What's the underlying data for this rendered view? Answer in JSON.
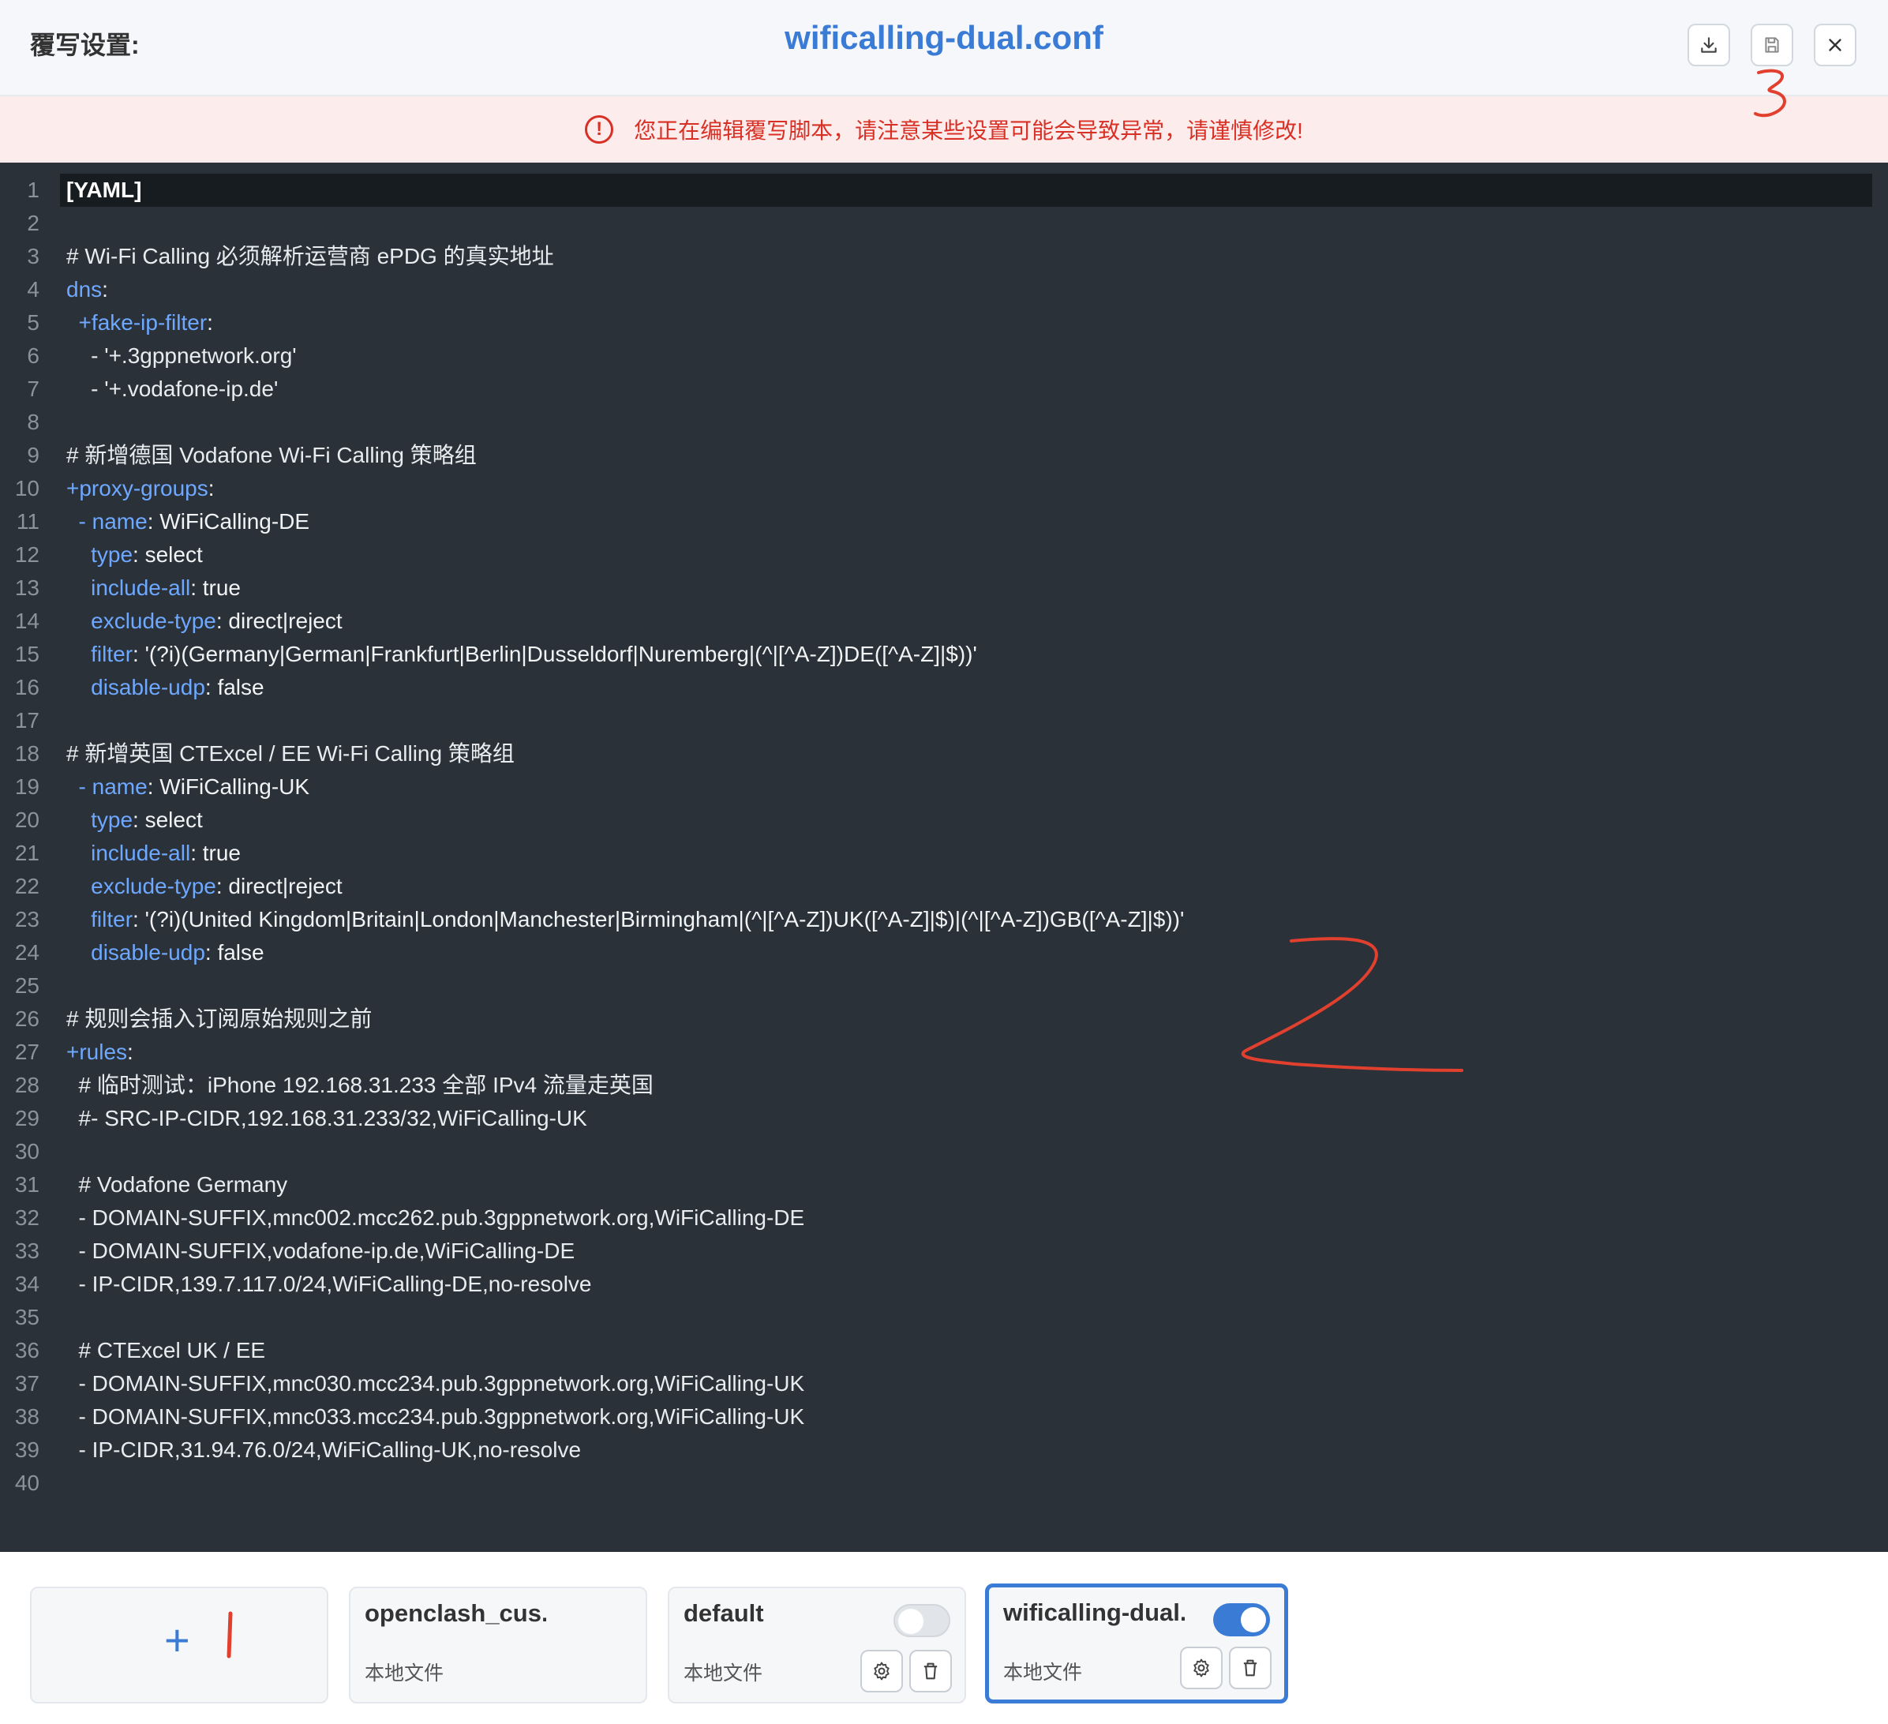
{
  "header": {
    "left_title": "覆写设置:",
    "file_title": "wificalling-dual.conf",
    "buttons": {
      "download": "download-icon",
      "save": "save-icon",
      "close": "close-icon"
    }
  },
  "warning": {
    "icon": "!",
    "text": "您正在编辑覆写脚本，请注意某些设置可能会导致异常，请谨慎修改!"
  },
  "editor": {
    "lines": [
      {
        "n": "1",
        "t": "[YAML]"
      },
      {
        "n": "2",
        "t": ""
      },
      {
        "n": "3",
        "t": "# Wi-Fi Calling 必须解析运营商 ePDG 的真实地址"
      },
      {
        "n": "4",
        "t": "dns:"
      },
      {
        "n": "5",
        "t": "  +fake-ip-filter:"
      },
      {
        "n": "6",
        "t": "    - '+.3gppnetwork.org'"
      },
      {
        "n": "7",
        "t": "    - '+.vodafone-ip.de'"
      },
      {
        "n": "8",
        "t": ""
      },
      {
        "n": "9",
        "t": "# 新增德国 Vodafone Wi-Fi Calling 策略组"
      },
      {
        "n": "10",
        "t": "+proxy-groups:"
      },
      {
        "n": "11",
        "t": "  - name: WiFiCalling-DE"
      },
      {
        "n": "12",
        "t": "    type: select"
      },
      {
        "n": "13",
        "t": "    include-all: true"
      },
      {
        "n": "14",
        "t": "    exclude-type: direct|reject"
      },
      {
        "n": "15",
        "t": "    filter: '(?i)(Germany|German|Frankfurt|Berlin|Dusseldorf|Nuremberg|(^|[^A-Z])DE([^A-Z]|$))'"
      },
      {
        "n": "16",
        "t": "    disable-udp: false"
      },
      {
        "n": "17",
        "t": ""
      },
      {
        "n": "18",
        "t": "# 新增英国 CTExcel / EE Wi-Fi Calling 策略组"
      },
      {
        "n": "19",
        "t": "  - name: WiFiCalling-UK"
      },
      {
        "n": "20",
        "t": "    type: select"
      },
      {
        "n": "21",
        "t": "    include-all: true"
      },
      {
        "n": "22",
        "t": "    exclude-type: direct|reject"
      },
      {
        "n": "23",
        "t": "    filter: '(?i)(United Kingdom|Britain|London|Manchester|Birmingham|(^|[^A-Z])UK([^A-Z]|$)|(^|[^A-Z])GB([^A-Z]|$))'"
      },
      {
        "n": "24",
        "t": "    disable-udp: false"
      },
      {
        "n": "25",
        "t": ""
      },
      {
        "n": "26",
        "t": "# 规则会插入订阅原始规则之前"
      },
      {
        "n": "27",
        "t": "+rules:"
      },
      {
        "n": "28",
        "t": "  # 临时测试：iPhone 192.168.31.233 全部 IPv4 流量走英国"
      },
      {
        "n": "29",
        "t": "  #- SRC-IP-CIDR,192.168.31.233/32,WiFiCalling-UK"
      },
      {
        "n": "30",
        "t": ""
      },
      {
        "n": "31",
        "t": "  # Vodafone Germany"
      },
      {
        "n": "32",
        "t": "  - DOMAIN-SUFFIX,mnc002.mcc262.pub.3gppnetwork.org,WiFiCalling-DE"
      },
      {
        "n": "33",
        "t": "  - DOMAIN-SUFFIX,vodafone-ip.de,WiFiCalling-DE"
      },
      {
        "n": "34",
        "t": "  - IP-CIDR,139.7.117.0/24,WiFiCalling-DE,no-resolve"
      },
      {
        "n": "35",
        "t": ""
      },
      {
        "n": "36",
        "t": "  # CTExcel UK / EE"
      },
      {
        "n": "37",
        "t": "  - DOMAIN-SUFFIX,mnc030.mcc234.pub.3gppnetwork.org,WiFiCalling-UK"
      },
      {
        "n": "38",
        "t": "  - DOMAIN-SUFFIX,mnc033.mcc234.pub.3gppnetwork.org,WiFiCalling-UK"
      },
      {
        "n": "39",
        "t": "  - IP-CIDR,31.94.76.0/24,WiFiCalling-UK,no-resolve"
      },
      {
        "n": "40",
        "t": ""
      }
    ]
  },
  "cards": [
    {
      "type": "add",
      "plus": "+"
    },
    {
      "name": "openclash_cus...",
      "sub": "本地文件",
      "toggle": null
    },
    {
      "name": "default",
      "sub": "本地文件",
      "toggle": "off"
    },
    {
      "name": "wificalling-dual...",
      "sub": "本地文件",
      "toggle": "on",
      "selected": true
    }
  ],
  "colors": {
    "accent": "#3a7bd5",
    "warning": "#d93025",
    "editor_bg": "#2a3138",
    "annotation": "#e2402e"
  }
}
